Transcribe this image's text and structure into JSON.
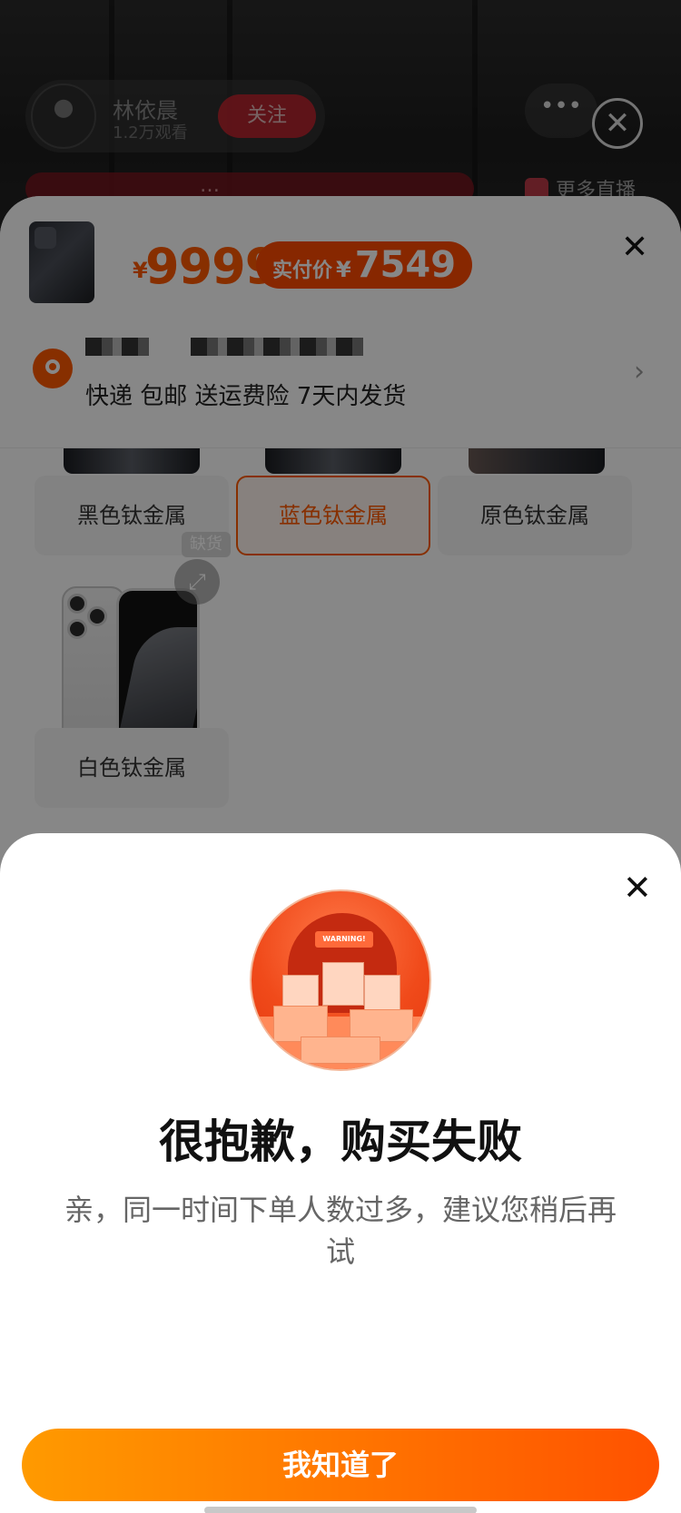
{
  "live": {
    "anchor_name": "林依晨",
    "anchor_sub": "1.2万观看",
    "follow_label": "关注",
    "more_label": "•••",
    "close_icon": "close-circle-icon",
    "ticker_text": "…",
    "more_live_label": "更多直播"
  },
  "sku": {
    "price_currency": "¥",
    "price": "9999",
    "real_price_label": "实付价",
    "real_price_currency": "¥",
    "real_price": "7549",
    "close_icon": "close-icon",
    "delivery_text": "快递 包邮  送运费险  7天内发货",
    "options": [
      {
        "label": "黑色钛金属",
        "selected": false
      },
      {
        "label": "蓝色钛金属",
        "selected": true
      },
      {
        "label": "原色钛金属",
        "selected": false
      },
      {
        "label": "白色钛金属",
        "selected": false
      }
    ],
    "soldout_tag": "缺货",
    "accent_color": "#ff5a00"
  },
  "modal": {
    "illustration_banner": "WARNING!",
    "title": "很抱歉，购买失败",
    "description": "亲，同一时间下单人数过多，建议您稍后再试",
    "confirm_label": "我知道了",
    "close_icon": "close-icon",
    "button_gradient": [
      "#ff9a00",
      "#ff5200"
    ]
  }
}
